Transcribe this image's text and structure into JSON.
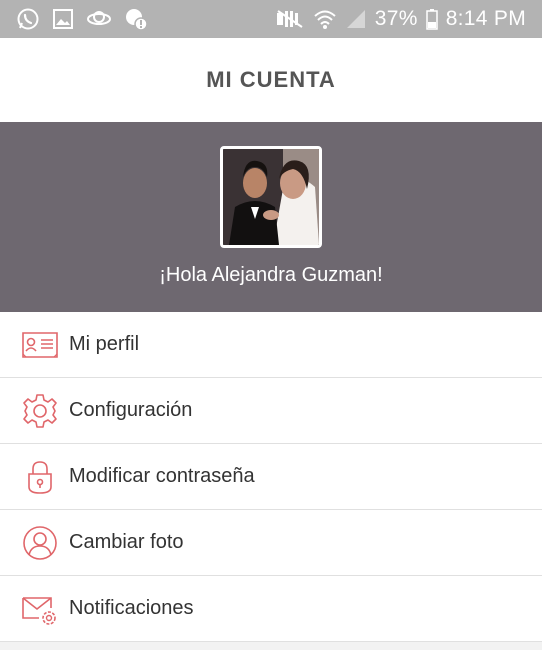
{
  "status_bar": {
    "battery": "37%",
    "time": "8:14 PM",
    "icons": [
      "whatsapp-icon",
      "gallery-icon",
      "sync-icon",
      "security-icon",
      "mute-icon",
      "wifi-icon",
      "signal-icon",
      "battery-icon"
    ]
  },
  "header": {
    "title": "MI CUENTA"
  },
  "profile": {
    "greeting": "¡Hola Alejandra Guzman!",
    "banner_color": "#6e6870"
  },
  "menu": {
    "accent_color": "#e0666a",
    "items": [
      {
        "label": "Mi perfil",
        "icon": "id-card-icon"
      },
      {
        "label": "Configuración",
        "icon": "gear-icon"
      },
      {
        "label": "Modificar contraseña",
        "icon": "lock-icon"
      },
      {
        "label": "Cambiar foto",
        "icon": "user-circle-icon"
      },
      {
        "label": "Notificaciones",
        "icon": "mail-settings-icon"
      }
    ]
  }
}
